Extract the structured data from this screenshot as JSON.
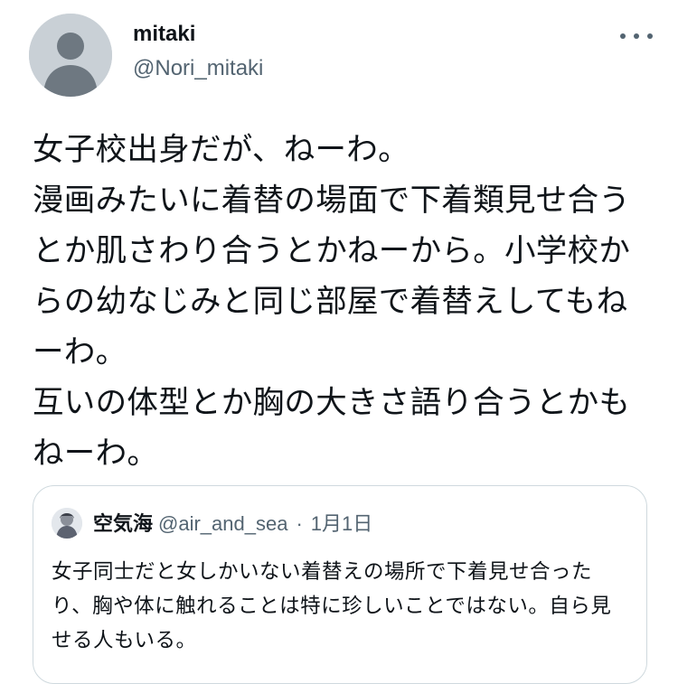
{
  "tweet": {
    "author": {
      "display_name": "mitaki",
      "handle": "@Nori_mitaki",
      "avatar_icon": "default-profile-icon"
    },
    "more_icon": "more-options-icon",
    "body_text": "女子校出身だが、ねーわ。\n漫画みたいに着替の場面で下着類見せ合うとか肌さわり合うとかねーから。小学校からの幼なじみと同じ部屋で着替えしてもねーわ。\n互いの体型とか胸の大きさ語り合うとかもねーわ。"
  },
  "quote": {
    "display_name": "空気海",
    "handle": "@air_and_sea",
    "separator": "·",
    "date": "1月1日",
    "text": "女子同士だと女しかいない着替えの場所で下着見せ合ったり、胸や体に触れることは特に珍しいことではない。自ら見せる人もいる。"
  },
  "colors": {
    "text_primary": "#0f1419",
    "text_secondary": "#536471",
    "border": "#cfd9de",
    "avatar_placeholder": "#c9d0d6"
  }
}
